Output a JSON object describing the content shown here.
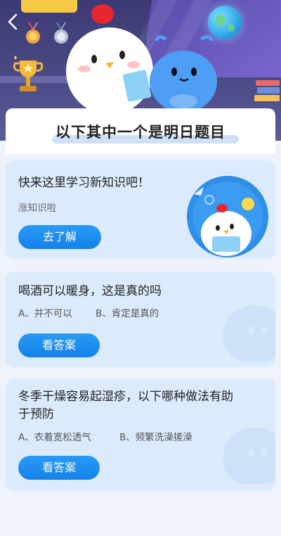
{
  "header": {
    "back_icon": "chevron-left-icon",
    "decor": [
      "medal-icon",
      "trophy-icon",
      "globe-icon",
      "books-icon",
      "chick-mascot",
      "alien-mascot"
    ]
  },
  "page_title": "以下其中一个是明日题目",
  "learn_card": {
    "title": "快来这里学习新知识吧！",
    "subtitle": "涨知识啦",
    "button_label": "去了解"
  },
  "questions": [
    {
      "title_lines": [
        "喝酒可以暖身，这是真的吗"
      ],
      "option_a": "A、并不可以",
      "option_b": "B、肯定是真的",
      "button_label": "看答案"
    },
    {
      "title_lines": [
        "冬季干燥容易起湿疹，以下哪种做法有助",
        "于预防"
      ],
      "option_a": "A、衣着宽松透气",
      "option_b": "B、频繁洗澡搓澡",
      "button_label": "看答案"
    }
  ],
  "colors": {
    "button_blue": "#1382ea",
    "card_bg": "#dcebfc",
    "page_bg": "#eef3fb",
    "banner_bg": "#3c3a73"
  }
}
